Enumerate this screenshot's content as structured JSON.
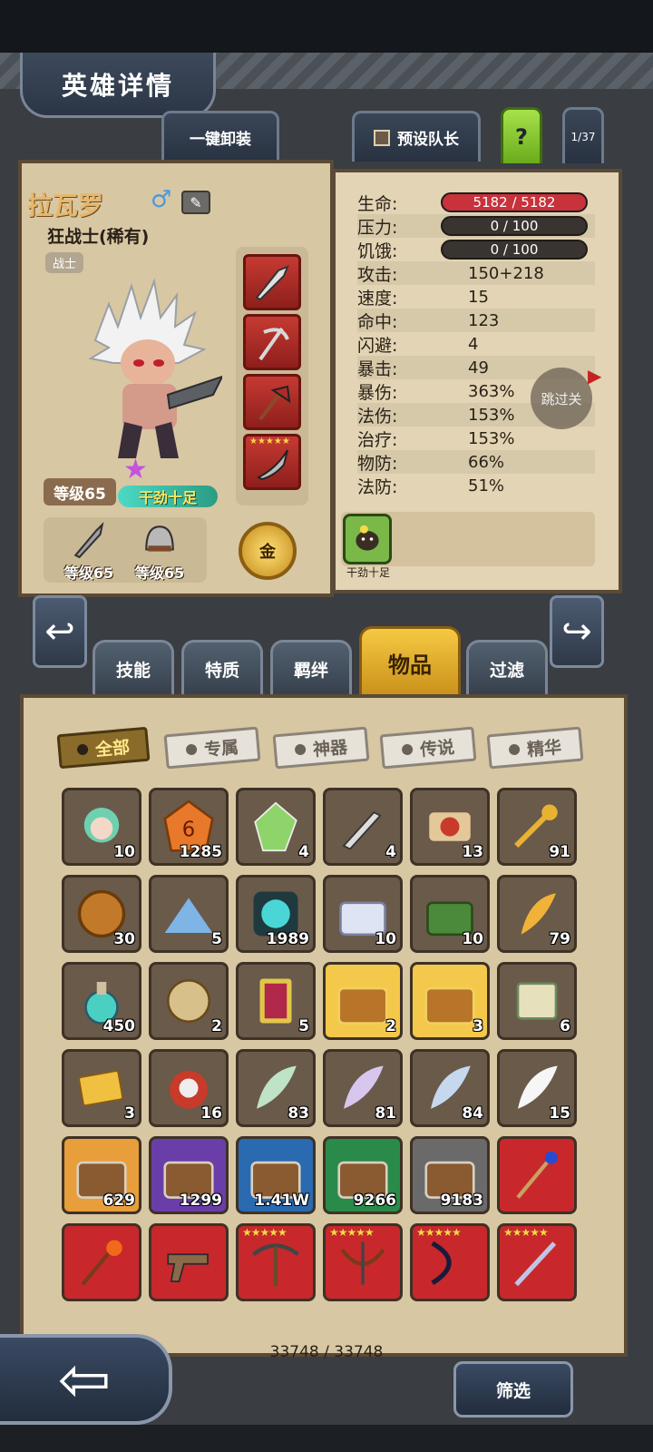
{
  "header": {
    "title": "英雄详情"
  },
  "top_tabs": {
    "unequip_all": "一键卸装",
    "preset_captain": "预设队长",
    "help": "?",
    "page": "1/37"
  },
  "hero": {
    "name": "拉瓦罗",
    "class_name": "狂战士(稀有)",
    "type": "战士",
    "level": "等级65",
    "state": "干劲十足",
    "weapon_level": "等级65",
    "armor_level": "等级65",
    "gold_badge": "金"
  },
  "stats": [
    {
      "label": "生命:",
      "value": "5182 / 5182",
      "kind": "bar-red"
    },
    {
      "label": "压力:",
      "value": "0 / 100",
      "kind": "bar"
    },
    {
      "label": "饥饿:",
      "value": "0 / 100",
      "kind": "bar"
    },
    {
      "label": "攻击:",
      "value": "150+218"
    },
    {
      "label": "速度:",
      "value": "15"
    },
    {
      "label": "命中:",
      "value": "123"
    },
    {
      "label": "闪避:",
      "value": "4"
    },
    {
      "label": "暴击:",
      "value": "49"
    },
    {
      "label": "暴伤:",
      "value": "363%"
    },
    {
      "label": "法伤:",
      "value": "153%"
    },
    {
      "label": "治疗:",
      "value": "153%"
    },
    {
      "label": "物防:",
      "value": "66%"
    },
    {
      "label": "法防:",
      "value": "51%"
    }
  ],
  "float_button": "跳过关",
  "trait": {
    "label": "干劲十足"
  },
  "section_tabs": [
    "技能",
    "特质",
    "羁绊",
    "物品",
    "过滤"
  ],
  "filter_tags": [
    "全部",
    "专属",
    "神器",
    "传说",
    "精华"
  ],
  "items": [
    {
      "icon": "hero-portrait",
      "count": "10"
    },
    {
      "icon": "orange-rune",
      "count": "1285"
    },
    {
      "icon": "rainbow-crystal",
      "count": "4"
    },
    {
      "icon": "knife",
      "count": "4"
    },
    {
      "icon": "scroll-seal",
      "count": "13"
    },
    {
      "icon": "golden-key",
      "count": "91"
    },
    {
      "icon": "bronze-coin",
      "count": "30"
    },
    {
      "icon": "blue-powder",
      "count": "5"
    },
    {
      "icon": "dark-emblem",
      "count": "1989"
    },
    {
      "icon": "silver-chest",
      "count": "10"
    },
    {
      "icon": "green-chest",
      "count": "10"
    },
    {
      "icon": "golden-feather",
      "count": "79"
    },
    {
      "icon": "potion",
      "count": "450"
    },
    {
      "icon": "vortex-orb",
      "count": "2"
    },
    {
      "icon": "red-scroll",
      "count": "5"
    },
    {
      "icon": "gold-chest",
      "count": "2"
    },
    {
      "icon": "gold-chest",
      "count": "3"
    },
    {
      "icon": "paper-scroll",
      "count": "6"
    },
    {
      "icon": "tickets",
      "count": "3"
    },
    {
      "icon": "skull-pot",
      "count": "16"
    },
    {
      "icon": "green-feather",
      "count": "83"
    },
    {
      "icon": "purple-feather",
      "count": "81"
    },
    {
      "icon": "blue-feather",
      "count": "84"
    },
    {
      "icon": "white-feather",
      "count": "15"
    },
    {
      "icon": "orange-chest",
      "count": "629"
    },
    {
      "icon": "purple-chest",
      "count": "1299"
    },
    {
      "icon": "blue-chest",
      "count": "1.41W"
    },
    {
      "icon": "green-chest-2",
      "count": "9266"
    },
    {
      "icon": "grey-chest",
      "count": "9183"
    },
    {
      "icon": "blue-staff",
      "count": ""
    },
    {
      "icon": "fire-staff",
      "count": ""
    },
    {
      "icon": "revolver",
      "count": ""
    },
    {
      "icon": "pickaxe",
      "count": ""
    },
    {
      "icon": "crossbow",
      "count": ""
    },
    {
      "icon": "dark-bow",
      "count": ""
    },
    {
      "icon": "silver-staff",
      "count": ""
    }
  ],
  "footer": {
    "count": "33748 / 33748",
    "filter_button": "筛选"
  },
  "colors": {
    "panel": "#d8c7a3",
    "accent": "#f5c942",
    "cell_red": "#c63a32"
  }
}
